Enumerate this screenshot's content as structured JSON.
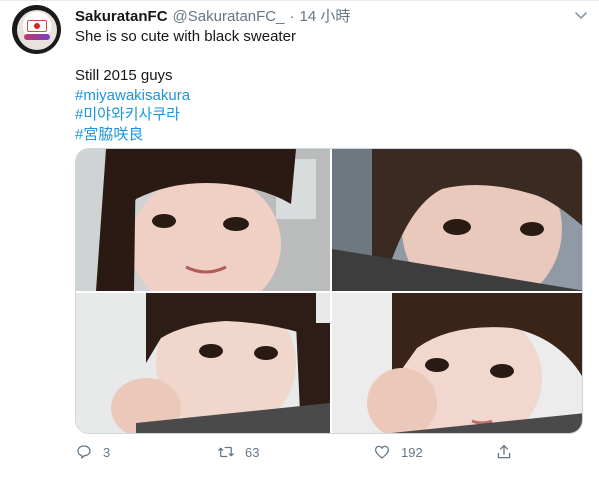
{
  "tweet": {
    "display_name": "SakuratanFC",
    "handle": "@SakuratanFC_",
    "separator": "·",
    "time": "14 小時",
    "lines": {
      "text1": "She is so cute with black sweater",
      "text2": "Still 2015 guys"
    },
    "hashtags": [
      "#miyawakisakura",
      "#미야와키사쿠라",
      "#宮脇咲良"
    ],
    "media": [
      "photo-1",
      "photo-2",
      "photo-3",
      "photo-4"
    ],
    "actions": {
      "reply_count": "3",
      "retweet_count": "63",
      "like_count": "192"
    },
    "icons": [
      "more-chevron-icon",
      "reply-icon",
      "retweet-icon",
      "like-icon",
      "share-icon"
    ],
    "colors": {
      "link": "#1b95e0",
      "muted": "#657786",
      "text": "#14171a"
    }
  }
}
